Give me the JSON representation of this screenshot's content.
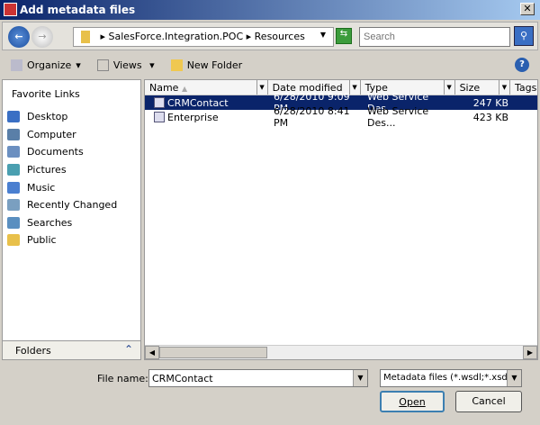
{
  "window": {
    "title": "Add metadata files",
    "close": "✕"
  },
  "nav": {
    "back": "←",
    "forward": "→",
    "path": [
      "SalesForce.Integration.POC",
      "Resources"
    ],
    "search_placeholder": "Search",
    "refresh": "⇆",
    "search_icon": "⚲"
  },
  "toolbar": {
    "organize": "Organize",
    "views": "Views",
    "new_folder": "New Folder",
    "help": "?"
  },
  "left": {
    "heading": "Favorite Links",
    "links": [
      {
        "label": "Desktop",
        "color": "#3a6fc4"
      },
      {
        "label": "Computer",
        "color": "#5a7fa8"
      },
      {
        "label": "Documents",
        "color": "#6b8fc0"
      },
      {
        "label": "Pictures",
        "color": "#4a9fb0"
      },
      {
        "label": "Music",
        "color": "#4a7fd0"
      },
      {
        "label": "Recently Changed",
        "color": "#7a9fc0"
      },
      {
        "label": "Searches",
        "color": "#5a8fc0"
      },
      {
        "label": "Public",
        "color": "#e8c04a"
      }
    ],
    "folders": "Folders",
    "folders_chevron": "⌃"
  },
  "list": {
    "columns": [
      "Name",
      "Date modified",
      "Type",
      "Size",
      "Tags"
    ],
    "rows": [
      {
        "name": "CRMContact",
        "date": "6/28/2010 9:09 PM",
        "type": "Web Service Des...",
        "size": "247 KB",
        "selected": true
      },
      {
        "name": "Enterprise",
        "date": "6/28/2010 8:41 PM",
        "type": "Web Service Des...",
        "size": "423 KB",
        "selected": false
      }
    ]
  },
  "footer": {
    "file_name_label": "File name:",
    "file_name": "CRMContact",
    "filter": "Metadata files (*.wsdl;*.xsd)",
    "open": "Open",
    "cancel": "Cancel"
  }
}
